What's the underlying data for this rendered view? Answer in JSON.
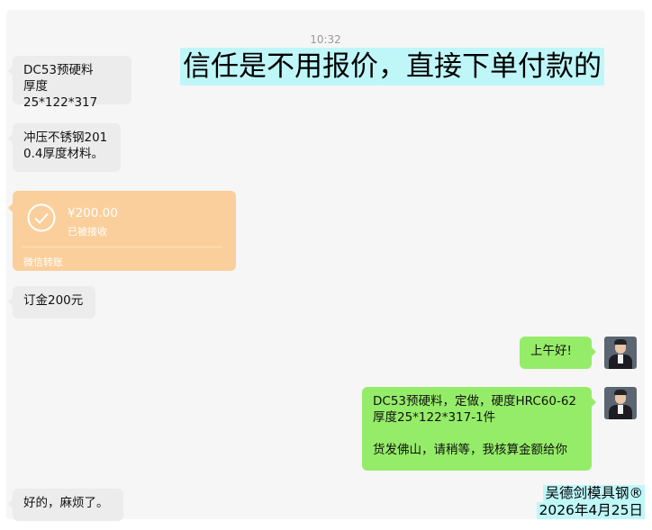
{
  "timestamp": "10:32",
  "headline": "信任是不用报价，直接下单付款的",
  "messages": {
    "m1": [
      "DC53预硬料",
      "厚度25*122*317"
    ],
    "m2": [
      "冲压不锈钢201",
      "0.4厚度材料。"
    ],
    "transfer": {
      "amount": "¥200.00",
      "status": "已被接收",
      "footer": "微信转账"
    },
    "m3": "订金200元",
    "m4": "上午好!",
    "m5": [
      "DC53预硬料，定做，硬度HRC60-62",
      "厚度25*122*317-1件",
      "",
      "货发佛山，请稍等，我核算金额给你"
    ],
    "m6": "好的，麻烦了。"
  },
  "brand": {
    "name": "吴德剑模具钢®",
    "date": "2026年4月25日"
  },
  "colors": {
    "incoming": "#ececec",
    "outgoing": "#95ec69",
    "transfer": "#fbcf9b",
    "highlight": "#bff7f9"
  }
}
